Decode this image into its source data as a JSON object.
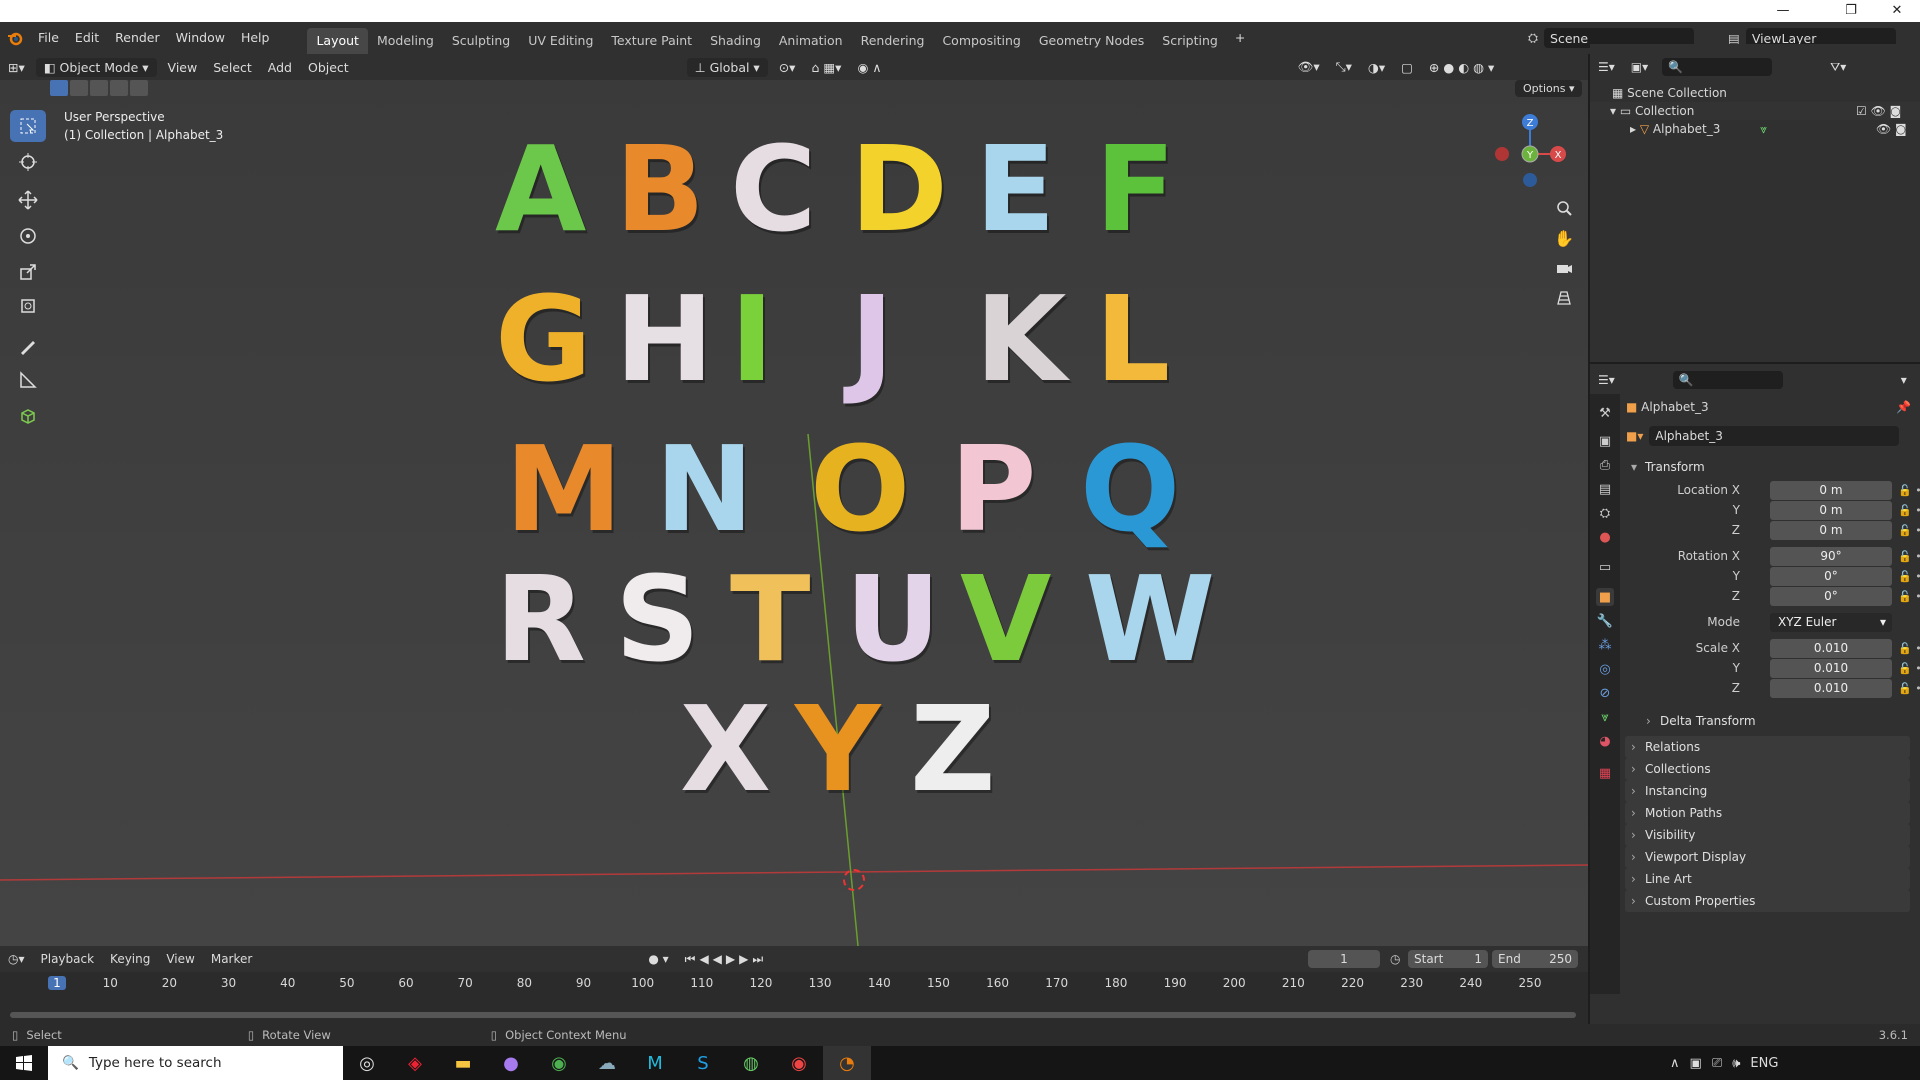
{
  "window": {
    "minimize": "—",
    "restore": "❐",
    "close": "✕"
  },
  "menu": {
    "app_icon": "blender-logo-icon",
    "items": [
      "File",
      "Edit",
      "Render",
      "Window",
      "Help"
    ],
    "workspaces": [
      "Layout",
      "Modeling",
      "Sculpting",
      "UV Editing",
      "Texture Paint",
      "Shading",
      "Animation",
      "Rendering",
      "Compositing",
      "Geometry Nodes",
      "Scripting"
    ],
    "add_tab": "+",
    "scene": "Scene",
    "view_layer": "ViewLayer"
  },
  "viewport": {
    "mode": "Object Mode",
    "menus": [
      "View",
      "Select",
      "Add",
      "Object"
    ],
    "transform_orientation": "Global",
    "options": "Options",
    "overlay_title": "User Perspective",
    "overlay_sub": "(1) Collection | Alphabet_3",
    "gizmo": {
      "z": "Z",
      "y": "Y",
      "x": "X"
    },
    "letters": [
      {
        "ch": "A",
        "color": "#6cc84a"
      },
      {
        "ch": "B",
        "color": "#e8892b"
      },
      {
        "ch": "C",
        "color": "#e6dde3"
      },
      {
        "ch": "D",
        "color": "#f3d22b"
      },
      {
        "ch": "E",
        "color": "#a9d6ec"
      },
      {
        "ch": "F",
        "color": "#5cc23c"
      },
      {
        "ch": "G",
        "color": "#f0b12a"
      },
      {
        "ch": "H",
        "color": "#e6dfe3"
      },
      {
        "ch": "I",
        "color": "#7bd13a"
      },
      {
        "ch": "J",
        "color": "#ddc6e8"
      },
      {
        "ch": "K",
        "color": "#d9d3d6"
      },
      {
        "ch": "L",
        "color": "#f2b93a"
      },
      {
        "ch": "M",
        "color": "#e8892b"
      },
      {
        "ch": "N",
        "color": "#a9d6ec"
      },
      {
        "ch": "O",
        "color": "#e6b21f"
      },
      {
        "ch": "P",
        "color": "#f2c6d3"
      },
      {
        "ch": "Q",
        "color": "#2b98d6"
      },
      {
        "ch": "R",
        "color": "#e6dde3"
      },
      {
        "ch": "S",
        "color": "#f0ecee"
      },
      {
        "ch": "T",
        "color": "#f0c05a"
      },
      {
        "ch": "U",
        "color": "#e4d4ea"
      },
      {
        "ch": "V",
        "color": "#7ccb3c"
      },
      {
        "ch": "W",
        "color": "#a9d6ec"
      },
      {
        "ch": "X",
        "color": "#e6dde3"
      },
      {
        "ch": "Y",
        "color": "#e8921f"
      },
      {
        "ch": "Z",
        "color": "#eeeeee"
      }
    ]
  },
  "outliner": {
    "scene_collection": "Scene Collection",
    "collection": "Collection",
    "object": "Alphabet_3"
  },
  "properties": {
    "object_name": "Alphabet_3",
    "data_name": "Alphabet_3",
    "transform": "Transform",
    "location_x_label": "Location X",
    "y_label": "Y",
    "z_label": "Z",
    "rotation_x_label": "Rotation X",
    "scale_x_label": "Scale X",
    "mode_label": "Mode",
    "location": [
      "0 m",
      "0 m",
      "0 m"
    ],
    "rotation": [
      "90°",
      "0°",
      "0°"
    ],
    "mode": "XYZ Euler",
    "scale": [
      "0.010",
      "0.010",
      "0.010"
    ],
    "delta": "Delta Transform",
    "panels": [
      "Relations",
      "Collections",
      "Instancing",
      "Motion Paths",
      "Visibility",
      "Viewport Display",
      "Line Art",
      "Custom Properties"
    ]
  },
  "timeline": {
    "menus": [
      "Playback",
      "Keying",
      "View",
      "Marker"
    ],
    "current_frame": "1",
    "start_label": "Start",
    "start": "1",
    "end_label": "End",
    "end": "250",
    "ticks": [
      "1",
      "10",
      "20",
      "30",
      "40",
      "50",
      "60",
      "70",
      "80",
      "90",
      "100",
      "110",
      "120",
      "130",
      "140",
      "150",
      "160",
      "170",
      "180",
      "190",
      "200",
      "210",
      "220",
      "230",
      "240",
      "250"
    ]
  },
  "status": {
    "select": "Select",
    "rotate": "Rotate View",
    "context": "Object Context Menu",
    "version": "3.6.1"
  },
  "taskbar": {
    "search_placeholder": "Type here to search",
    "lang": "ENG"
  }
}
